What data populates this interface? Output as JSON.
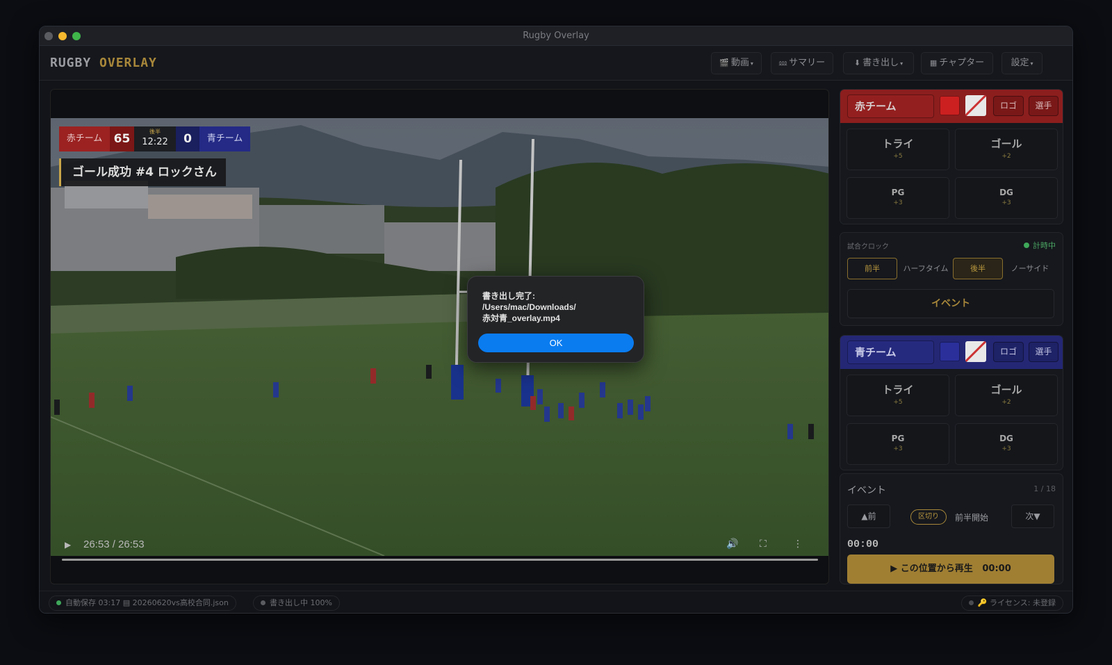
{
  "window": {
    "title": "Rugby Overlay"
  },
  "brand": {
    "part1": "RUGBY",
    "part2": "OVERLAY"
  },
  "menu": [
    {
      "icon": "🎬",
      "label": "動画",
      "caret": "▾"
    },
    {
      "icon": "⅏",
      "label": "サマリー",
      "caret": ""
    },
    {
      "icon": "⬇",
      "label": "書き出し",
      "caret": "▾"
    },
    {
      "icon": "▦",
      "label": "チャプター",
      "caret": ""
    },
    {
      "icon": "",
      "label": "設定",
      "caret": "▾"
    }
  ],
  "scorebug": {
    "red_name": "赤チーム",
    "red_score": "65",
    "period": "後半",
    "clock": "12:22",
    "blue_score": "0",
    "blue_name": "青チーム"
  },
  "goal_banner": "ゴール成功 #4 ロックさん",
  "player": {
    "time": "26:53 / 26:53",
    "progress": 1.0
  },
  "dialog": {
    "message": "書き出し完了:\n/Users/mac/Downloads/\n赤対青_overlay.mp4",
    "ok": "OK"
  },
  "red_team": {
    "name": "赤チーム",
    "color": "#cc2020",
    "logo": "ロゴ",
    "players": "選手",
    "try": "トライ",
    "try_pts": "+5",
    "goal": "ゴール",
    "goal_pts": "+2",
    "pg": "PG",
    "pg_pts": "+3",
    "dg": "DG",
    "dg_pts": "+3"
  },
  "clock": {
    "title": "試合クロック",
    "status": "計時中",
    "periods": [
      "前半",
      "ハーフタイム",
      "後半",
      "ノーサイド"
    ],
    "event": "イベント"
  },
  "blue_team": {
    "name": "青チーム",
    "color": "#2a2f9a",
    "logo": "ロゴ",
    "players": "選手",
    "try": "トライ",
    "try_pts": "+5",
    "goal": "ゴール",
    "goal_pts": "+2",
    "pg": "PG",
    "pg_pts": "+3",
    "dg": "DG",
    "dg_pts": "+3"
  },
  "events": {
    "title": "イベント",
    "count": "1 / 18",
    "prev": "▲前",
    "next": "次▼",
    "tag": "区切り",
    "label": "前半開始",
    "time": "00:00",
    "play": "▶ この位置から再生",
    "play_time": "00:00"
  },
  "status": {
    "autosave": "自動保存 03:17",
    "file_icon": "▤",
    "file": "20260620vs高校合同.json",
    "export": "書き出し中 100%",
    "license": "🔑 ライセンス: 未登録"
  }
}
